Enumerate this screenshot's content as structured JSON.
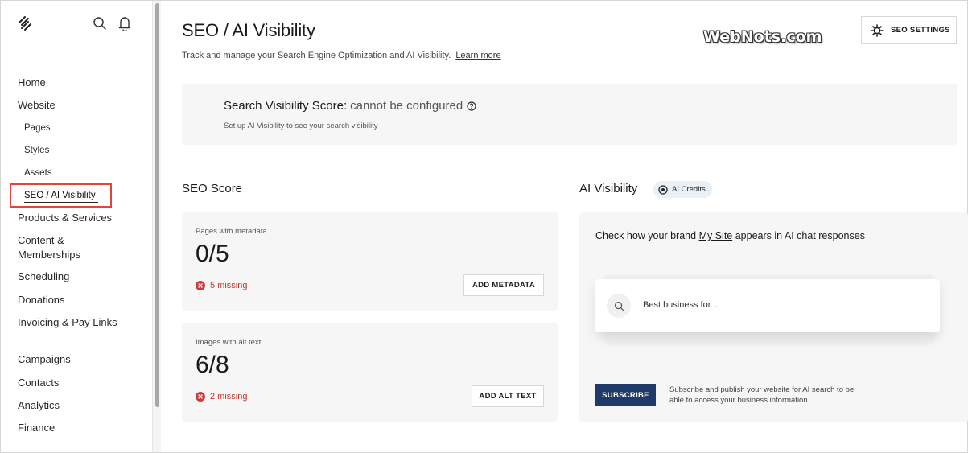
{
  "sidebar": {
    "logo_icon": "squarespace-logo-icon",
    "search_icon": "search-icon",
    "bell_icon": "bell-icon",
    "items": [
      {
        "label": "Home"
      },
      {
        "label": "Website"
      },
      {
        "label": "Pages"
      },
      {
        "label": "Styles"
      },
      {
        "label": "Assets"
      },
      {
        "label": "SEO / AI Visibility"
      },
      {
        "label": "Products & Services"
      },
      {
        "label": "Content &"
      },
      {
        "label": "Memberships"
      },
      {
        "label": "Scheduling"
      },
      {
        "label": "Donations"
      },
      {
        "label": "Invoicing & Pay Links"
      },
      {
        "label": "Campaigns"
      },
      {
        "label": "Contacts"
      },
      {
        "label": "Analytics"
      },
      {
        "label": "Finance"
      }
    ],
    "active_highlight_color": "#e0453b"
  },
  "header": {
    "title": "SEO / AI Visibility",
    "description": "Track and manage your Search Engine Optimization and AI Visibility.",
    "learn_more": "Learn more",
    "watermark": "WebNots.com",
    "settings_button": "SEO SETTINGS"
  },
  "visibility": {
    "title_key": "Search Visibility Score:",
    "title_value": "cannot be configured",
    "subtitle": "Set up AI Visibility to see your search visibility"
  },
  "seo_score": {
    "heading": "SEO Score",
    "cards": [
      {
        "label": "Pages with metadata",
        "value": "0/5",
        "missing": "5 missing",
        "button": "ADD METADATA"
      },
      {
        "label": "Images with alt text",
        "value": "6/8",
        "missing": "2 missing",
        "button": "ADD ALT TEXT"
      }
    ]
  },
  "ai_visibility": {
    "heading": "AI Visibility",
    "credits_badge": "AI Credits",
    "prompt_prefix": "Check how your brand",
    "brand": "My Site",
    "prompt_suffix": "appears in AI chat responses",
    "search_placeholder": "Best business for...",
    "subscribe_button": "SUBSCRIBE",
    "subscribe_note": "Subscribe and publish your website for AI search to be able to access your business information.",
    "accent_color": "#1f3a68"
  }
}
